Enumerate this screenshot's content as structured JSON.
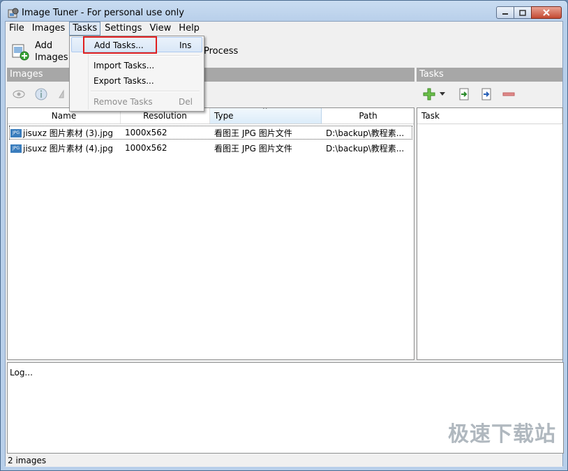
{
  "window": {
    "title": "Image Tuner - For personal use only"
  },
  "menu": [
    "File",
    "Images",
    "Tasks",
    "Settings",
    "View",
    "Help"
  ],
  "toolbar": {
    "add_images_label": "Add\nImages",
    "process_label": "Process"
  },
  "images_panel": {
    "header": "Images",
    "columns": [
      "Name",
      "Resolution",
      "Type",
      "Path"
    ],
    "rows": [
      {
        "name": "jisuxz 图片素材 (3).jpg",
        "resolution": "1000x562",
        "type": "看图王 JPG 图片文件",
        "path": "D:\\backup\\教程素..."
      },
      {
        "name": "jisuxz 图片素材 (4).jpg",
        "resolution": "1000x562",
        "type": "看图王 JPG 图片文件",
        "path": "D:\\backup\\教程素..."
      }
    ],
    "file_icon_label": "JPG"
  },
  "tasks_panel": {
    "header": "Tasks",
    "columns": [
      "Task"
    ]
  },
  "tasks_menu": {
    "items": [
      {
        "label": "Add Tasks...",
        "shortcut": "Ins"
      },
      {
        "label": "Import Tasks...",
        "shortcut": ""
      },
      {
        "label": "Export Tasks...",
        "shortcut": ""
      },
      {
        "label": "Remove Tasks",
        "shortcut": "Del"
      }
    ]
  },
  "log": {
    "text": "Log..."
  },
  "status": {
    "text": "2 images"
  },
  "watermark": "极速下载站",
  "colors": {
    "highlight": "#e02020",
    "panel_header": "#a7a7a7",
    "title_gradient": "#b8cfea"
  }
}
